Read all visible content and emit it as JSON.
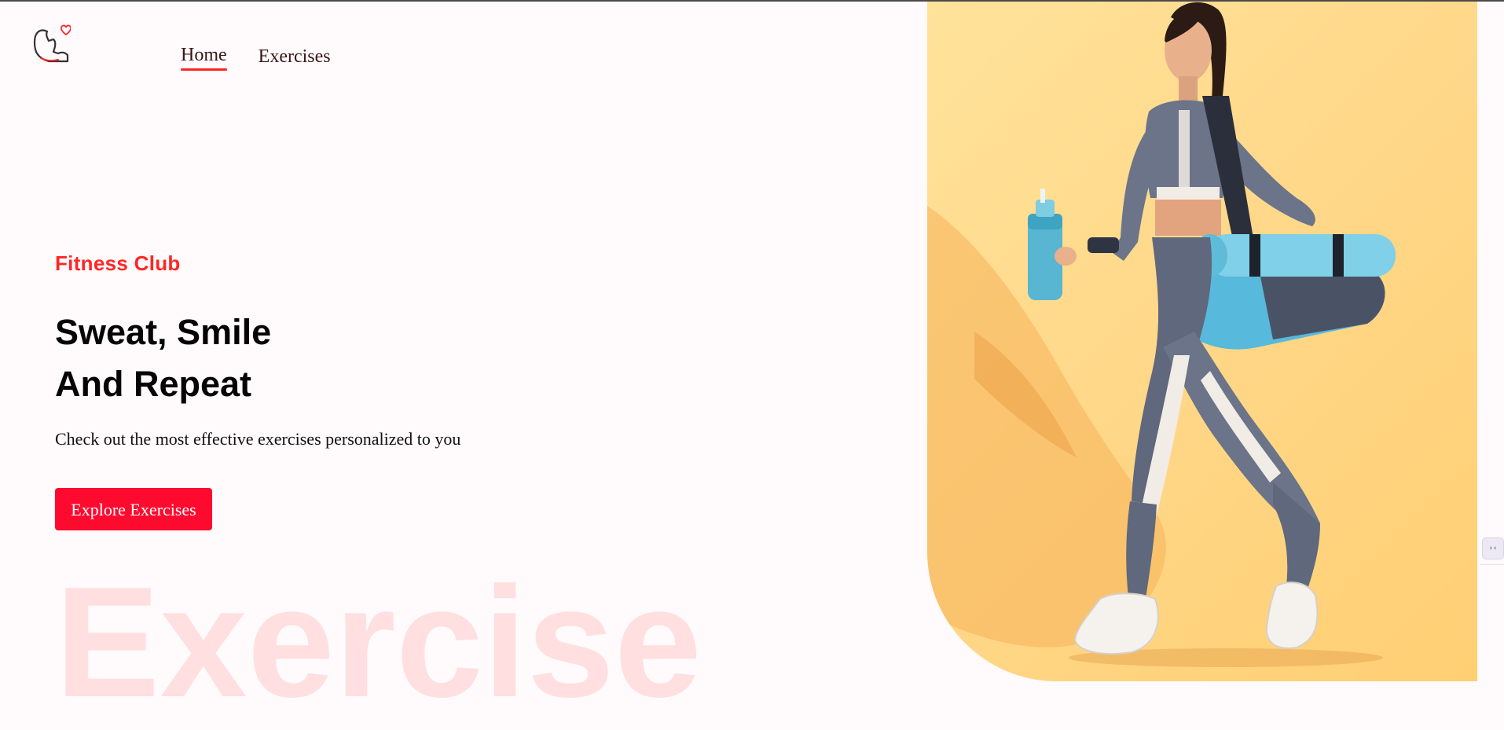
{
  "navbar": {
    "logo_icon": "flexed-bicep-heart-icon",
    "links": [
      {
        "label": "Home",
        "active": true
      },
      {
        "label": "Exercises",
        "active": false
      }
    ]
  },
  "hero": {
    "kicker": "Fitness Club",
    "title_line1": "Sweat, Smile",
    "title_line2": "And Repeat",
    "subtitle": "Check out the most effective exercises personalized to you",
    "cta_label": "Explore Exercises",
    "watermark": "Exercise",
    "image_subject": "woman walking with water bottle, yoga mat and gym bag"
  },
  "colors": {
    "accent": "#ff2625",
    "button": "#ff0a2f",
    "page_background": "#fffafb",
    "image_background": "#ffd88a"
  },
  "side_widget": {
    "icon": "translate-widget-icon",
    "glyph": "›‹"
  }
}
